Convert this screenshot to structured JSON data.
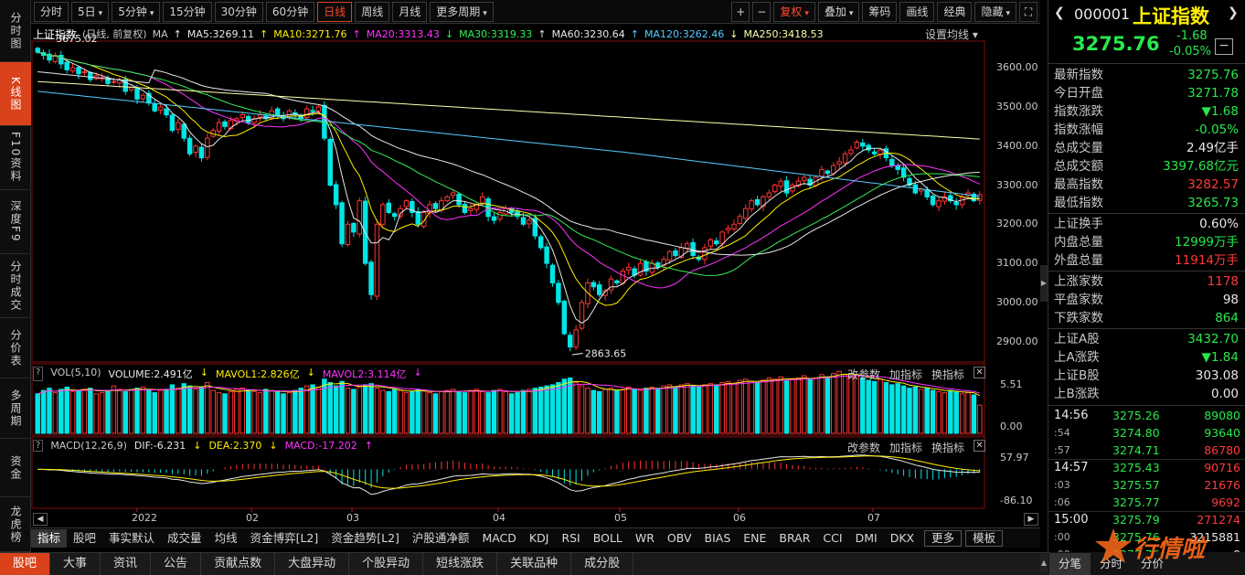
{
  "left_tabs": [
    {
      "label": "分时图",
      "name": "tab-intraday"
    },
    {
      "label": "K线图",
      "name": "tab-kline"
    },
    {
      "label": "F10资料",
      "name": "tab-f10"
    },
    {
      "label": "深度F9",
      "name": "tab-depth"
    },
    {
      "label": "分时成交",
      "name": "tab-intraday-trades"
    },
    {
      "label": "分价表",
      "name": "tab-price-table"
    },
    {
      "label": "多周期",
      "name": "tab-multi-period"
    },
    {
      "label": "资金",
      "name": "tab-funds"
    },
    {
      "label": "龙虎榜",
      "name": "tab-dragon-tiger"
    }
  ],
  "period_buttons": [
    "分时",
    "5日",
    "5分钟",
    "15分钟",
    "30分钟",
    "60分钟",
    "日线",
    "周线",
    "月线",
    "更多周期"
  ],
  "right_buttons": [
    "复权",
    "叠加",
    "筹码",
    "画线",
    "经典",
    "隐藏"
  ],
  "info": {
    "name": "上证指数",
    "mode": "(日线, 前复权)",
    "ma_label": "MA",
    "ma": [
      {
        "label": "MA5:3269.11",
        "color": "#e8e8e8"
      },
      {
        "label": "MA10:3271.76",
        "color": "#ffee00"
      },
      {
        "label": "MA20:3313.43",
        "color": "#ff33ff"
      },
      {
        "label": "MA30:3319.33",
        "color": "#33ee55"
      },
      {
        "label": "MA60:3230.64",
        "color": "#e8e8e8"
      },
      {
        "label": "MA120:3262.46",
        "color": "#55ccff"
      },
      {
        "label": "MA250:3418.53",
        "color": "#ffffaa"
      }
    ],
    "settings": "设置均线"
  },
  "price_axis": [
    "3600.00",
    "3500.00",
    "3400.00",
    "3300.00",
    "3200.00",
    "3100.00",
    "3000.00",
    "2900.00"
  ],
  "annotations": {
    "high": "3675.02",
    "low": "2863.65"
  },
  "vol": {
    "label": "VOL(5,10)",
    "volume": "VOLUME:2.491亿",
    "mavol1": "MAVOL1:2.826亿",
    "mavol2": "MAVOL2:3.114亿",
    "axis_top": "5.51",
    "axis_bottom": "0.00"
  },
  "macd": {
    "label": "MACD(12,26,9)",
    "dif": "DIF:-6.231",
    "dea": "DEA:2.370",
    "macd": "MACD:-17.202",
    "axis_top": "57.97",
    "axis_bottom": "-86.10"
  },
  "panel_buttons": {
    "params": "改参数",
    "add": "加指标",
    "switch": "换指标"
  },
  "date_axis": [
    "2022",
    "02",
    "03",
    "04",
    "05",
    "06",
    "07"
  ],
  "indicators": [
    "指标",
    "股吧",
    "事实默认",
    "成交量",
    "均线",
    "资金博弈[L2]",
    "资金趋势[L2]",
    "沪股通净额",
    "MACD",
    "KDJ",
    "RSI",
    "BOLL",
    "WR",
    "OBV",
    "BIAS",
    "ENE",
    "BRAR",
    "CCI",
    "DMI",
    "DKX",
    "更多",
    "模板"
  ],
  "footer_tabs": [
    "股吧",
    "大事",
    "资讯",
    "公告",
    "贡献点数",
    "大盘异动",
    "个股异动",
    "短线涨跌",
    "关联品种",
    "成分股"
  ],
  "quote": {
    "code": "000001",
    "name": "上证指数",
    "price": "3275.76",
    "change": "-1.68",
    "pct": "-0.05%",
    "rows": [
      {
        "k": "最新指数",
        "v": "3275.76",
        "c": "g"
      },
      {
        "k": "今日开盘",
        "v": "3271.78",
        "c": "g"
      },
      {
        "k": "指数涨跌",
        "v": "▼1.68",
        "c": "g"
      },
      {
        "k": "指数涨幅",
        "v": "-0.05%",
        "c": "g"
      },
      {
        "k": "总成交量",
        "v": "2.49亿手",
        "c": "w"
      },
      {
        "k": "总成交额",
        "v": "3397.68亿元",
        "c": "g"
      },
      {
        "k": "最高指数",
        "v": "3282.57",
        "c": "r"
      },
      {
        "k": "最低指数",
        "v": "3265.73",
        "c": "g"
      }
    ],
    "rows2": [
      {
        "k": "上证换手",
        "v": "0.60%",
        "c": "w"
      },
      {
        "k": "内盘总量",
        "v": "12999万手",
        "c": "g"
      },
      {
        "k": "外盘总量",
        "v": "11914万手",
        "c": "r"
      }
    ],
    "rows3": [
      {
        "k": "上涨家数",
        "v": "1178",
        "c": "r"
      },
      {
        "k": "平盘家数",
        "v": "98",
        "c": "w"
      },
      {
        "k": "下跌家数",
        "v": "864",
        "c": "g"
      }
    ],
    "rows4": [
      {
        "k": "上证A股",
        "v": "3432.70",
        "c": "g"
      },
      {
        "k": "上A涨跌",
        "v": "▼1.84",
        "c": "g"
      },
      {
        "k": "上证B股",
        "v": "303.08",
        "c": "w"
      },
      {
        "k": "上B涨跌",
        "v": "0.00",
        "c": "w"
      }
    ],
    "ticks": [
      {
        "t": "14:56",
        "p": "3275.26",
        "v": "89080",
        "vc": "g"
      },
      {
        "t": ":54",
        "p": "3274.80",
        "v": "93640",
        "vc": "g"
      },
      {
        "t": ":57",
        "p": "3274.71",
        "v": "86780",
        "vc": "r"
      },
      {
        "t": "14:57",
        "p": "3275.43",
        "v": "90716",
        "vc": "r"
      },
      {
        "t": ":03",
        "p": "3275.57",
        "v": "21676",
        "vc": "r"
      },
      {
        "t": ":06",
        "p": "3275.77",
        "v": "9692",
        "vc": "r"
      },
      {
        "t": "15:00",
        "p": "3275.79",
        "v": "271274",
        "vc": "r"
      },
      {
        "t": ":00",
        "p": "3275.76",
        "v": "3215881",
        "vc": "w"
      },
      {
        "t": ":00",
        "p": "3275.76",
        "v": "0",
        "vc": "w"
      }
    ],
    "bottom_tabs": [
      "分笔",
      "分时",
      "分价"
    ]
  },
  "chart_data": {
    "type": "candlestick",
    "title": "上证指数",
    "ylim": [
      2850,
      3680
    ],
    "close": [
      3640,
      3632,
      3620,
      3632,
      3610,
      3595,
      3600,
      3585,
      3590,
      3570,
      3580,
      3575,
      3560,
      3565,
      3570,
      3540,
      3550,
      3520,
      3530,
      3510,
      3490,
      3500,
      3480,
      3440,
      3460,
      3420,
      3380,
      3400,
      3370,
      3420,
      3440,
      3460,
      3450,
      3465,
      3470,
      3480,
      3460,
      3470,
      3480,
      3470,
      3490,
      3480,
      3470,
      3490,
      3480,
      3470,
      3495,
      3490,
      3500,
      3420,
      3300,
      3250,
      3150,
      3200,
      3180,
      3260,
      3100,
      3020,
      3200,
      3250,
      3230,
      3220,
      3240,
      3260,
      3230,
      3200,
      3230,
      3250,
      3240,
      3260,
      3270,
      3280,
      3250,
      3230,
      3240,
      3250,
      3270,
      3220,
      3210,
      3230,
      3240,
      3230,
      3220,
      3200,
      3210,
      3170,
      3140,
      3100,
      3050,
      3000,
      2920,
      2886,
      2930,
      3000,
      3050,
      3040,
      3020,
      3030,
      3060,
      3050,
      3080,
      3090,
      3070,
      3100,
      3080,
      3100,
      3090,
      3110,
      3130,
      3120,
      3140,
      3150,
      3120,
      3110,
      3140,
      3160,
      3150,
      3180,
      3190,
      3200,
      3220,
      3240,
      3260,
      3250,
      3270,
      3280,
      3300,
      3310,
      3280,
      3300,
      3310,
      3320,
      3300,
      3320,
      3340,
      3330,
      3350,
      3360,
      3380,
      3390,
      3410,
      3400,
      3390,
      3380,
      3390,
      3370,
      3350,
      3340,
      3320,
      3300,
      3280,
      3290,
      3270,
      3250,
      3260,
      3270,
      3260,
      3250,
      3270,
      3280,
      3260,
      3275.76
    ],
    "volume": [
      3.5,
      3.8,
      4.0,
      3.6,
      3.9,
      4.1,
      3.7,
      3.8,
      3.9,
      4.0,
      3.5,
      3.6,
      3.8,
      4.2,
      3.9,
      3.7,
      3.8,
      4.0,
      4.1,
      3.9,
      3.6,
      3.8,
      3.9,
      4.3,
      4.0,
      4.4,
      4.2,
      3.9,
      4.1,
      4.5,
      3.8,
      3.6,
      3.5,
      3.7,
      3.9,
      4.0,
      3.8,
      3.7,
      3.6,
      3.9,
      3.8,
      3.7,
      3.5,
      3.6,
      3.8,
      4.0,
      4.2,
      4.3,
      4.1,
      4.8,
      4.5,
      4.2,
      4.6,
      4.0,
      3.9,
      4.1,
      4.3,
      4.4,
      4.0,
      3.8,
      3.7,
      3.9,
      3.8,
      3.6,
      3.7,
      3.9,
      3.8,
      3.6,
      3.5,
      3.7,
      3.8,
      3.9,
      3.7,
      3.6,
      3.8,
      3.9,
      3.7,
      3.6,
      3.8,
      3.9,
      3.7,
      3.5,
      3.6,
      3.8,
      3.9,
      4.0,
      4.1,
      4.2,
      4.3,
      4.5,
      4.8,
      4.9,
      4.5,
      4.2,
      4.0,
      3.8,
      3.7,
      3.9,
      4.0,
      3.8,
      3.9,
      4.1,
      3.9,
      3.8,
      4.0,
      4.1,
      4.0,
      4.2,
      4.3,
      4.1,
      4.3,
      4.4,
      4.2,
      4.1,
      4.3,
      4.4,
      4.3,
      4.5,
      4.6,
      4.4,
      4.7,
      4.8,
      4.6,
      4.5,
      4.7,
      4.9,
      4.8,
      5.0,
      4.7,
      4.8,
      4.9,
      5.1,
      4.8,
      4.9,
      5.2,
      5.0,
      5.3,
      5.5,
      5.2,
      5.0,
      5.1,
      4.9,
      4.7,
      4.6,
      4.8,
      4.5,
      4.3,
      4.4,
      4.2,
      4.0,
      4.1,
      3.9,
      4.0,
      3.8,
      3.7,
      3.6,
      3.8,
      3.7,
      3.5,
      3.6,
      3.4,
      2.5
    ],
    "vol_ylim": [
      0,
      5.51
    ],
    "macd_ylim": [
      -86.1,
      57.97
    ],
    "x_labels": [
      "2022",
      "02",
      "03",
      "04",
      "05",
      "06",
      "07"
    ]
  },
  "watermark": "行情啦"
}
